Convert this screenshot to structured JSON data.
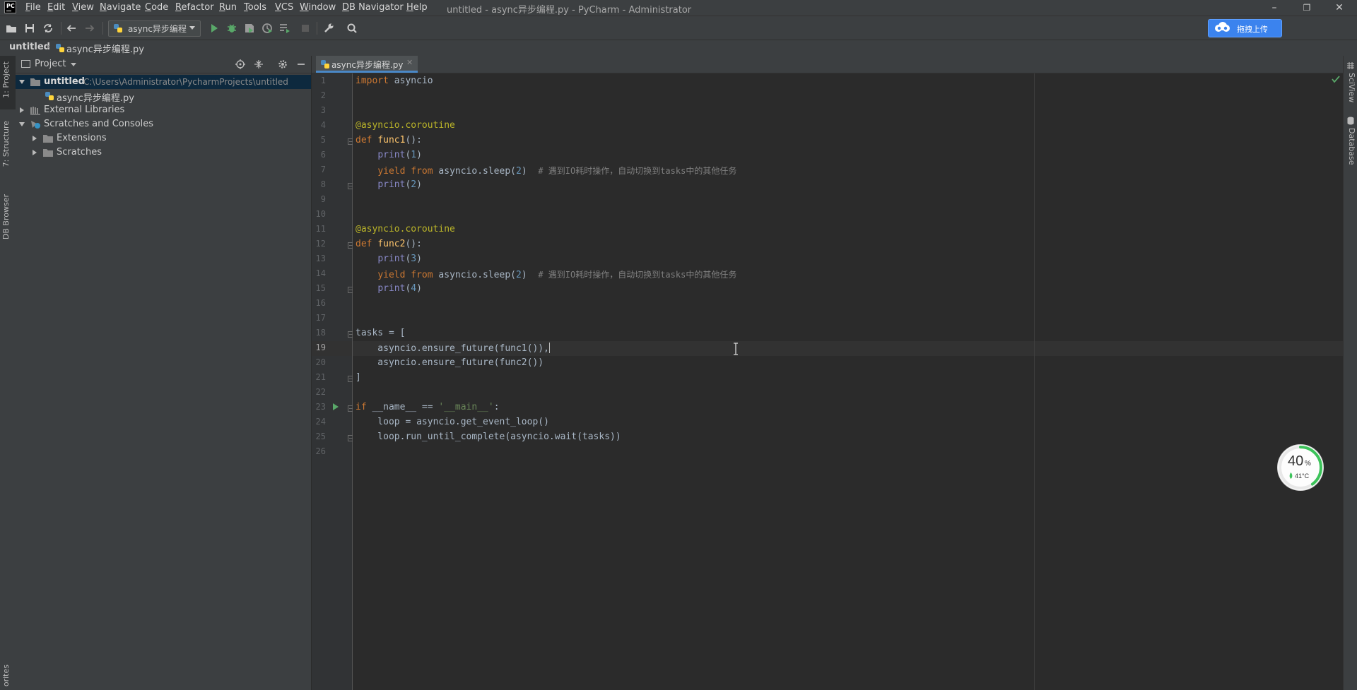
{
  "menubar": {
    "items": [
      "File",
      "Edit",
      "View",
      "Navigate",
      "Code",
      "Refactor",
      "Run",
      "Tools",
      "VCS",
      "Window",
      "DB Navigator",
      "Help"
    ],
    "window_title": "untitled - async异步编程.py - PyCharm - Administrator"
  },
  "toolbar": {
    "run_config": "async异步编程",
    "upload_label": "拖拽上传"
  },
  "navbar": {
    "project": "untitled",
    "file": "async异步编程.py"
  },
  "left_strip": {
    "tabs": [
      "1: Project",
      "7: Structure",
      "DB Browser",
      "orites"
    ]
  },
  "project_panel": {
    "title": "Project",
    "tree": [
      {
        "label": "untitled",
        "path": "C:\\Users\\Administrator\\PycharmProjects\\untitled"
      },
      {
        "label": "async异步编程.py"
      },
      {
        "label": "External Libraries"
      },
      {
        "label": "Scratches and Consoles"
      },
      {
        "label": "Extensions"
      },
      {
        "label": "Scratches"
      }
    ]
  },
  "editor": {
    "tab_label": "async异步编程.py",
    "current_line": 19,
    "line_numbers": [
      "1",
      "2",
      "3",
      "4",
      "5",
      "6",
      "7",
      "8",
      "9",
      "10",
      "11",
      "12",
      "13",
      "14",
      "15",
      "16",
      "17",
      "18",
      "19",
      "20",
      "21",
      "22",
      "23",
      "24",
      "25",
      "26"
    ],
    "code": {
      "l1_kw": "import",
      "l1_rest": " asyncio",
      "l4_dec": "@asyncio.coroutine",
      "l5_kw": "def",
      "l5_fn": "func1",
      "l5_rest": "():",
      "l6_bi": "print",
      "l6_open": "(",
      "l6_num": "1",
      "l6_close": ")",
      "l7_kw1": "yield",
      "l7_kw2": "from",
      "l7_mid": " asyncio.sleep(",
      "l7_num": "2",
      "l7_close": ")  ",
      "l7_cm": "# 遇到IO耗时操作，自动切换到tasks中的其他任务",
      "l8_bi": "print",
      "l8_open": "(",
      "l8_num": "2",
      "l8_close": ")",
      "l11_dec": "@asyncio.coroutine",
      "l12_kw": "def",
      "l12_fn": "func2",
      "l12_rest": "():",
      "l13_bi": "print",
      "l13_open": "(",
      "l13_num": "3",
      "l13_close": ")",
      "l14_kw1": "yield",
      "l14_kw2": "from",
      "l14_mid": " asyncio.sleep(",
      "l14_num": "2",
      "l14_close": ")  ",
      "l14_cm": "# 遇到IO耗时操作，自动切换到tasks中的其他任务",
      "l15_bi": "print",
      "l15_open": "(",
      "l15_num": "4",
      "l15_close": ")",
      "l18": "tasks = [",
      "l19": "    asyncio.ensure_future(func1()),",
      "l20": "    asyncio.ensure_future(func2())",
      "l21": "]",
      "l23_kw": "if",
      "l23_mid": " __name__ == ",
      "l23_str": "'__main__'",
      "l23_end": ":",
      "l24": "    loop = asyncio.get_event_loop()",
      "l25": "    loop.run_until_complete(asyncio.wait(tasks))"
    }
  },
  "right_strip": {
    "tabs": [
      "SciView",
      "Database"
    ]
  },
  "perf_widget": {
    "percent": "40",
    "percent_unit": "%",
    "temperature": "41°C"
  },
  "colors": {
    "background": "#2b2b2b",
    "panel": "#3c3f41",
    "keyword": "#cc7832",
    "decorator": "#bbb529",
    "function": "#ffc66d",
    "number": "#6897bb",
    "builtin": "#8888c6",
    "comment": "#808080",
    "string": "#6a8759",
    "accent": "#4a88c7",
    "upload_button": "#3b83ee"
  },
  "icons": [
    "pycharm-logo-icon",
    "open-folder-icon",
    "save-icon",
    "sync-icon",
    "back-arrow-icon",
    "forward-arrow-icon",
    "python-file-icon",
    "run-icon",
    "debug-icon",
    "coverage-icon",
    "profile-icon",
    "concurrency-icon",
    "stop-icon",
    "wrench-icon",
    "search-icon",
    "cloud-icon",
    "locate-icon",
    "collapse-icon",
    "gear-icon",
    "minimize-icon",
    "checkmark-icon",
    "run-gutter-icon",
    "text-cursor-icon"
  ]
}
